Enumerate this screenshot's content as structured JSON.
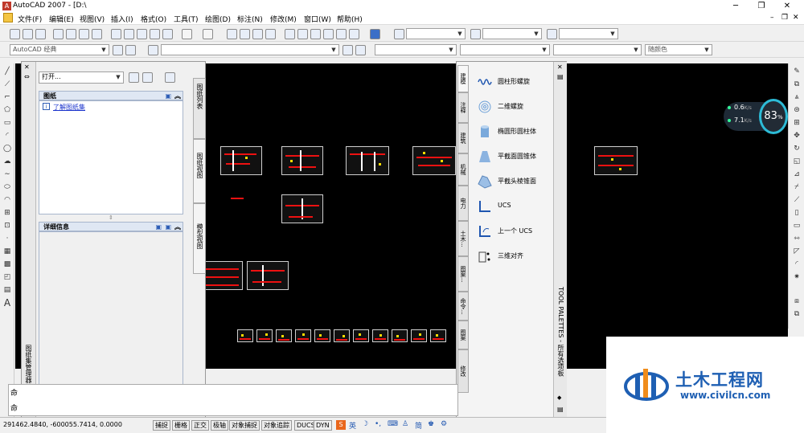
{
  "window": {
    "title": "AutoCAD 2007 - [D:\\"
  },
  "menu": [
    "文件(F)",
    "编辑(E)",
    "视图(V)",
    "插入(I)",
    "格式(O)",
    "工具(T)",
    "绘图(D)",
    "标注(N)",
    "修改(M)",
    "窗口(W)",
    "帮助(H)"
  ],
  "workspace": {
    "combo_value": "AutoCAD 经典"
  },
  "color_combo": {
    "value": "随颜色"
  },
  "sheet_manager": {
    "open_combo": "打开...",
    "sheets_panel_title": "图纸",
    "sheets_link": "了解图纸集",
    "details_panel_title": "详细信息",
    "side_title": "图纸集管理器",
    "tabs": [
      "图纸列表",
      "图纸视图",
      "模型视图"
    ]
  },
  "tool_palette": {
    "title": "TOOL PALETTES - 所有选项板",
    "tabs": [
      "建模",
      "注释",
      "建筑",
      "机械",
      "电力",
      "土木...",
      "图案...",
      "命令...",
      "图案",
      "修改"
    ],
    "tools": [
      {
        "label": "圆柱形螺旋",
        "icon": "helix-icon"
      },
      {
        "label": "二维螺旋",
        "icon": "spiral-icon"
      },
      {
        "label": "椭圆形圆柱体",
        "icon": "cylinder-icon"
      },
      {
        "label": "平截面圆锥体",
        "icon": "cone-icon"
      },
      {
        "label": "平截头棱锥面",
        "icon": "pyramid-icon"
      },
      {
        "label": "UCS",
        "icon": "ucs-icon"
      },
      {
        "label": "上一个 UCS",
        "icon": "ucs-previous-icon"
      },
      {
        "label": "三维对齐",
        "icon": "align-3d-icon"
      }
    ]
  },
  "command": {
    "label1": "命",
    "label2": "命"
  },
  "status": {
    "coords": "291462.4840, -600055.7414, 0.0000",
    "buttons": [
      "捕捉",
      "栅格",
      "正交",
      "极轴",
      "对象捕捉",
      "对象追踪",
      "DUCS",
      "DYN"
    ],
    "ime": [
      "英",
      "简"
    ]
  },
  "netmon": {
    "percent": "83",
    "percent_unit": "%",
    "up": "0.6",
    "up_unit": "K/s",
    "down": "7.1",
    "down_unit": "K/s"
  },
  "watermark": {
    "brand": "土木工程网",
    "url": "www.civilcn.com"
  }
}
